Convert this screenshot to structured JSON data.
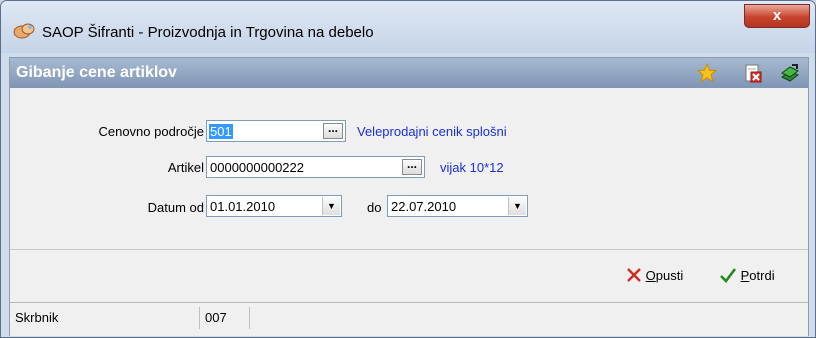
{
  "window": {
    "title": "SAOP Šifranti  - Proizvodnja in Trgovina na debelo",
    "close_glyph": "x"
  },
  "panel": {
    "title": "Gibanje cene artiklov"
  },
  "header_icons": [
    "star-icon",
    "delete-document-icon",
    "exit-book-icon"
  ],
  "form": {
    "price_area": {
      "label": "Cenovno področje",
      "value": "501",
      "description": "Veleprodajni cenik splošni",
      "browse": "..."
    },
    "article": {
      "label": "Artikel",
      "value": "0000000000222",
      "description": "vijak 10*12",
      "browse": "..."
    },
    "date_from": {
      "label": "Datum od",
      "value": "01.01.2010"
    },
    "date_to": {
      "label": "do",
      "value": "22.07.2010"
    }
  },
  "actions": {
    "cancel": {
      "label_first": "O",
      "label_rest": "pusti"
    },
    "confirm": {
      "label_first": "P",
      "label_rest": "otrdi"
    }
  },
  "status": {
    "left": "Skrbnik",
    "code": "007",
    "extra": ""
  },
  "colors": {
    "header": "#8ea3bf",
    "link_text": "#1a2fd6",
    "selection": "#3399ff",
    "close_button": "#c8442f"
  }
}
